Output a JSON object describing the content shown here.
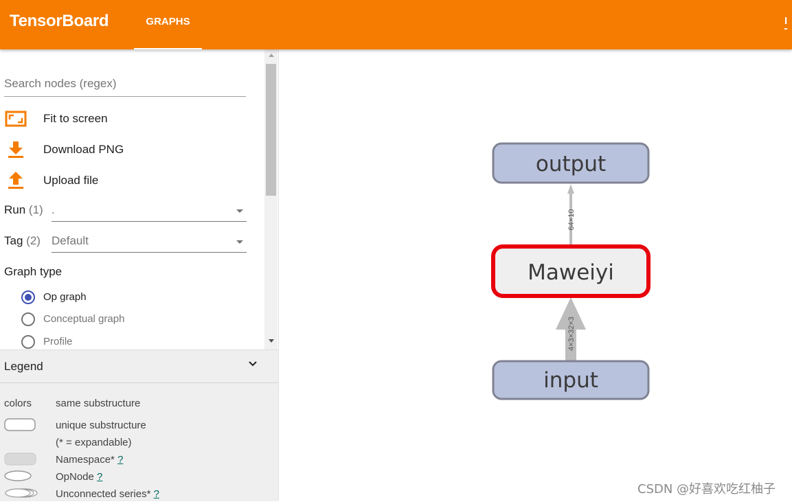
{
  "app": {
    "brand": "TensorBoard",
    "active_tab": "GRAPHS",
    "top_right_text": "I"
  },
  "sidebar": {
    "search_placeholder": "Search nodes (regex)",
    "actions": [
      {
        "icon": "fit-to-screen-icon",
        "label": "Fit to screen"
      },
      {
        "icon": "download-icon",
        "label": "Download PNG"
      },
      {
        "icon": "upload-icon",
        "label": "Upload file"
      }
    ],
    "run": {
      "label": "Run",
      "count": "(1)",
      "value": "."
    },
    "tag": {
      "label": "Tag",
      "count": "(2)",
      "value": "Default"
    },
    "graph_type": {
      "title": "Graph type",
      "options": [
        {
          "label": "Op graph",
          "selected": true
        },
        {
          "label": "Conceptual graph",
          "selected": false
        },
        {
          "label": "Profile",
          "selected": false
        }
      ]
    }
  },
  "legend": {
    "title": "Legend",
    "colors_label": "colors",
    "same_substructure": "same substructure",
    "unique_substructure": "unique substructure",
    "expandable_note": "(* = expandable)",
    "namespace": "Namespace*",
    "opnode": "OpNode",
    "unconnected": "Unconnected series*",
    "help": "?"
  },
  "graph": {
    "nodes": [
      {
        "id": "output",
        "label": "output"
      },
      {
        "id": "maweiyi",
        "label": "Maweiyi",
        "selected": true
      },
      {
        "id": "input",
        "label": "input"
      }
    ],
    "edges": [
      {
        "from": "maweiyi",
        "to": "output",
        "shape_label": "64×10"
      },
      {
        "from": "input",
        "to": "maweiyi",
        "shape_label": "4×3×32×3"
      }
    ],
    "colors": {
      "node_fill": "#b9c2dd",
      "node_stroke": "#7f8393",
      "selected_stroke": "#e8000c",
      "selected_fill": "#efefef",
      "edge": "#bdbdbd"
    }
  },
  "watermark": "CSDN @好喜欢吃红柚子"
}
